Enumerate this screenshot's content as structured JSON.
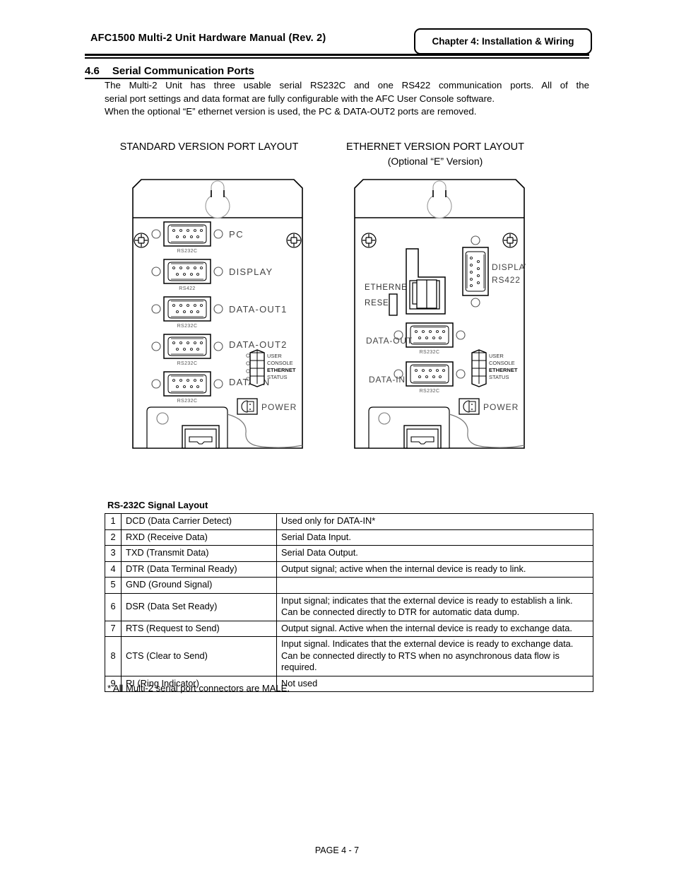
{
  "header": {
    "manual_title": "AFC1500  Multi-2  Unit  Hardware  Manual  (Rev. 2)",
    "chapter_badge": "Chapter 4: Installation & Wiring"
  },
  "section": {
    "number": "4.6",
    "title": "Serial Communication Ports",
    "paragraph_line1": "The Multi-2 Unit has three usable serial RS232C and one RS422 communication ports. All of the",
    "paragraph_line2": "serial port settings and data format are fully configurable with the AFC User Console software.",
    "paragraph_line3": "When the optional “E” ethernet version is used, the PC & DATA-OUT2 ports are removed."
  },
  "diagrams": {
    "standard": {
      "caption": "STANDARD VERSION PORT LAYOUT",
      "ports": [
        {
          "label": "PC",
          "sub": "RS232C"
        },
        {
          "label": "DISPLAY",
          "sub": "RS422"
        },
        {
          "label": "DATA-OUT1",
          "sub": "RS232C"
        },
        {
          "label": "DATA-OUT2",
          "sub": "RS232C"
        },
        {
          "label": "DATA-IN",
          "sub": "RS232C"
        }
      ],
      "leds": [
        "USER",
        "CONSOLE",
        "ETHERNET",
        "STATUS"
      ],
      "power_label": "POWER"
    },
    "ethernet": {
      "caption": "ETHERNET VERSION PORT LAYOUT",
      "subcaption": "(Optional  “E”   Version)",
      "ethernet_label": "ETHERNET",
      "reset_label": "RESET",
      "display_label": "DISPLAY",
      "display_sub": "RS422",
      "ports": [
        {
          "label": "DATA-OUT",
          "sub": "RS232C"
        },
        {
          "label": "DATA-IN",
          "sub": "RS232C"
        }
      ],
      "leds": [
        "USER",
        "CONSOLE",
        "ETHERNET",
        "STATUS"
      ],
      "power_label": "POWER"
    }
  },
  "signal_table": {
    "title": "RS-232C Signal Layout",
    "rows": [
      {
        "pin": "1",
        "signal": "DCD (Data Carrier Detect)",
        "description": "Used only for DATA-IN*"
      },
      {
        "pin": "2",
        "signal": "RXD (Receive Data)",
        "description": "Serial Data Input."
      },
      {
        "pin": "3",
        "signal": "TXD (Transmit Data)",
        "description": "Serial Data Output."
      },
      {
        "pin": "4",
        "signal": "DTR (Data Terminal Ready)",
        "description": "Output signal; active when the internal device is ready to link."
      },
      {
        "pin": "5",
        "signal": "GND (Ground Signal)",
        "description": ""
      },
      {
        "pin": "6",
        "signal": "DSR (Data Set Ready)",
        "description": "Input signal; indicates that the external device is ready to establish a link. Can be connected directly to DTR for automatic data dump."
      },
      {
        "pin": "7",
        "signal": "RTS (Request to Send)",
        "description": "Output signal. Active when the internal device is ready to exchange data."
      },
      {
        "pin": "8",
        "signal": "CTS (Clear to Send)",
        "description": "Input signal. Indicates that the external device is ready to exchange data. Can be connected directly to RTS when no asynchronous data flow is required."
      },
      {
        "pin": "9",
        "signal": "RI (Ring Indicator)",
        "description": "Not used"
      }
    ],
    "note": "* All Multi-2 serial port connectors are MALE."
  },
  "footer": {
    "page_label": "PAGE 4 - 7"
  }
}
